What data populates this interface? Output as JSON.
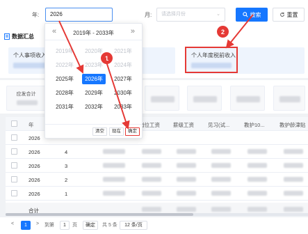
{
  "filter": {
    "year_label": "年:",
    "year_value": "2026",
    "month_label": "月:",
    "month_placeholder": "请选择月份",
    "search_label": "搜索",
    "reset_label": "重置"
  },
  "summary": {
    "title": "数据汇总",
    "card1_label": "个人事项收入",
    "card2_label": "个人年度税前收入"
  },
  "stats": {
    "first_label": "应发合计"
  },
  "picker": {
    "range": "2019年 - 2033年",
    "prev": "«",
    "next": "»",
    "years": [
      {
        "label": "2019年",
        "state": "disabled"
      },
      {
        "label": "2020年",
        "state": "disabled"
      },
      {
        "label": "2021年",
        "state": "disabled"
      },
      {
        "label": "2022年",
        "state": "disabled"
      },
      {
        "label": "2023年",
        "state": "disabled"
      },
      {
        "label": "2024年",
        "state": "disabled"
      },
      {
        "label": "2025年",
        "state": "normal"
      },
      {
        "label": "2026年",
        "state": "selected"
      },
      {
        "label": "2027年",
        "state": "normal"
      },
      {
        "label": "2028年",
        "state": "normal"
      },
      {
        "label": "2029年",
        "state": "normal"
      },
      {
        "label": "2030年",
        "state": "normal"
      },
      {
        "label": "2031年",
        "state": "normal"
      },
      {
        "label": "2032年",
        "state": "normal"
      },
      {
        "label": "2033年",
        "state": "normal"
      }
    ],
    "clear_label": "清空",
    "now_label": "现在",
    "ok_label": "确定"
  },
  "table": {
    "headers": [
      "年",
      "基本工资",
      "岗位工资",
      "薪级工资",
      "见习(试...",
      "教护10...",
      "教护龄津贴"
    ],
    "rows": [
      {
        "year": "2026",
        "month": ""
      },
      {
        "year": "2026",
        "month": "4"
      },
      {
        "year": "2026",
        "month": "3"
      },
      {
        "year": "2026",
        "month": "2"
      },
      {
        "year": "2026",
        "month": "1"
      }
    ],
    "total_label": "合计"
  },
  "pagination": {
    "prev": "<",
    "current": "1",
    "next": ">",
    "goto_label": "到第",
    "page_input": "1",
    "page_unit": "页",
    "confirm_label": "确定",
    "total_text": "共 5 条",
    "page_size": "12 条/页"
  },
  "annotations": {
    "badge1": "1",
    "badge2": "2"
  },
  "colors": {
    "primary": "#1677ff",
    "annotation_red": "#e53935"
  }
}
